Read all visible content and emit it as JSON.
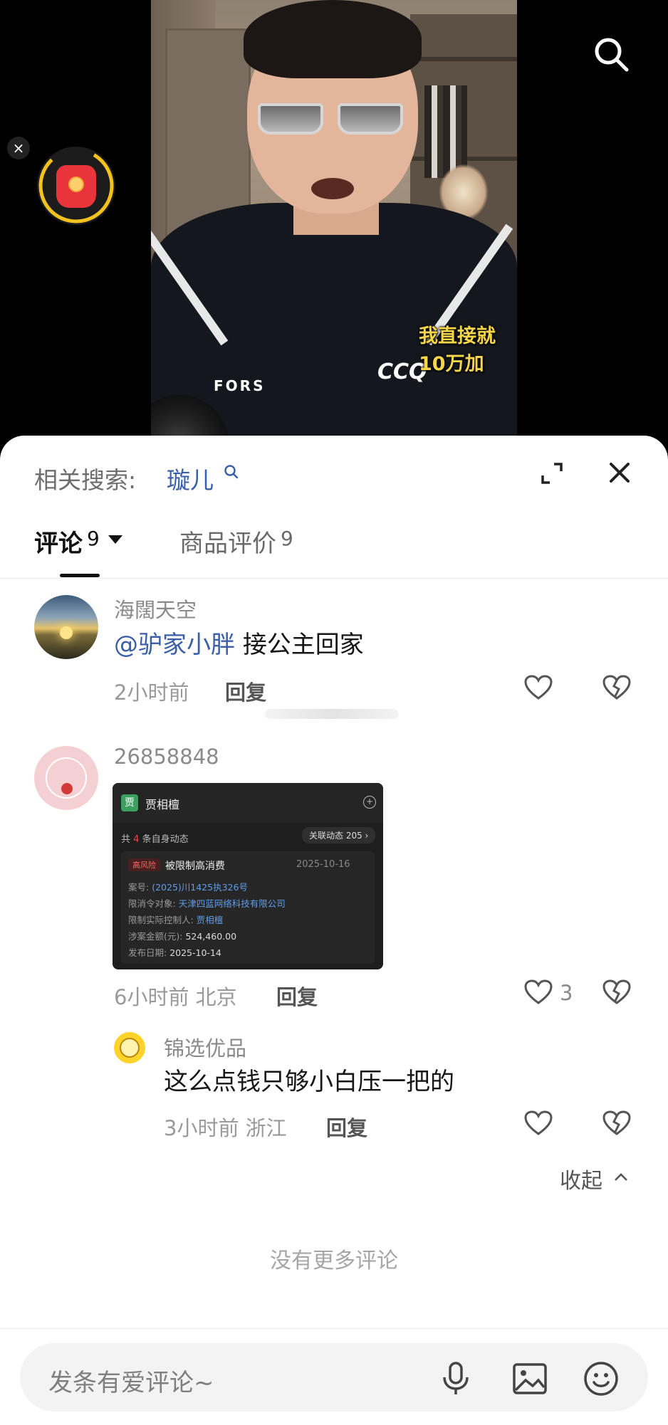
{
  "video": {
    "subtitle": "我直接就10万加",
    "logo_left": "FORS",
    "logo_right": "CCQ"
  },
  "overlay": {
    "search_icon": "search-icon",
    "red_packet_icon": "red-packet-icon",
    "close_icon": "close-icon",
    "red_packet_color": "#e8343a",
    "ring_color": "#f4c21f"
  },
  "panel": {
    "related_label": "相关搜索:",
    "related_term": "璇儿",
    "expand_icon": "expand-icon",
    "close_icon": "close-icon"
  },
  "tabs": [
    {
      "label": "评论",
      "count": "9",
      "active": true
    },
    {
      "label": "商品评价",
      "count": "9",
      "active": false
    }
  ],
  "comments": [
    {
      "username": "海闊天空",
      "mention": "@驴家小胖",
      "text": "接公主回家",
      "time": "2小时前",
      "reply": "回复"
    },
    {
      "username": "26858848",
      "time": "6小时前 北京",
      "reply": "回复",
      "likes": "3",
      "image_card": {
        "name": "贾相檀",
        "logo": "贾",
        "sub_prefix": "共",
        "sub_count": "4",
        "sub_suffix": "条自身动态",
        "pill": "关联动态 205 ›",
        "tag": "高风险",
        "title": "被限制高消费",
        "date": "2025-10-16",
        "rows": [
          {
            "k": "案号:",
            "v": "(2025)川1425执326号",
            "blue": true
          },
          {
            "k": "限消令对象:",
            "v": "天津四蓝网络科技有限公司",
            "blue": true
          },
          {
            "k": "限制实际控制人:",
            "v": "贾相檀",
            "blue": true
          },
          {
            "k": "涉案金额(元):",
            "v": "524,460.00",
            "blue": false
          },
          {
            "k": "发布日期:",
            "v": "2025-10-14",
            "blue": false
          }
        ]
      }
    },
    {
      "username": "锦选优品",
      "text": "这么点钱只够小白压一把的",
      "time": "3小时前 浙江",
      "reply": "回复"
    }
  ],
  "collapse_label": "收起",
  "no_more": "没有更多评论",
  "input": {
    "placeholder": "发条有爱评论~",
    "icons": [
      "microphone-icon",
      "image-icon",
      "emoji-icon"
    ]
  }
}
